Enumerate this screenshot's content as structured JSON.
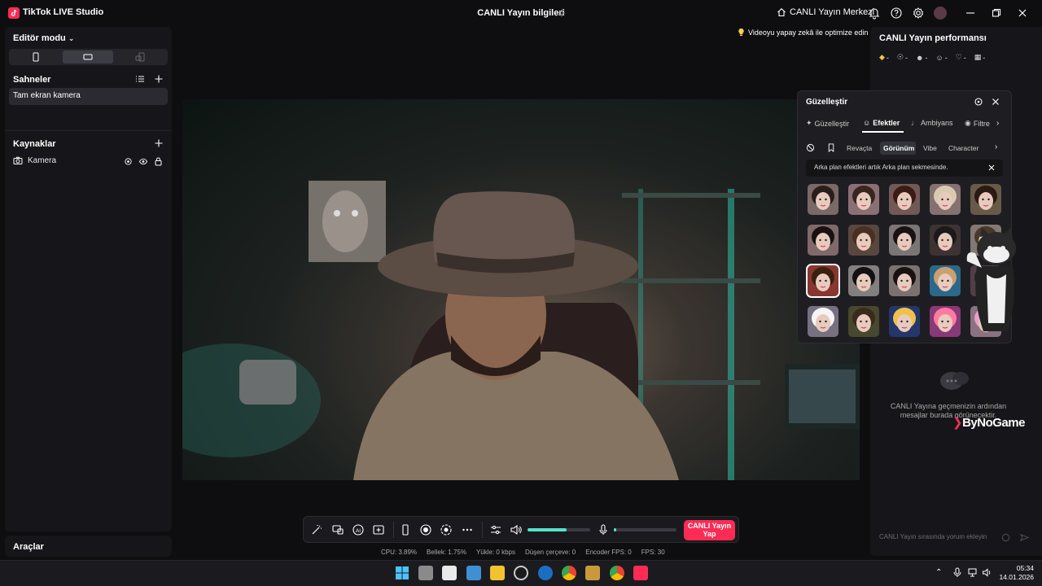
{
  "app": {
    "title": "TikTok LIVE Studio",
    "center_title": "CANLI Yayın bilgileri",
    "live_center": "CANLI Yayın Merkezi"
  },
  "left": {
    "editor_mode": "Editör modu",
    "scenes_label": "Sahneler",
    "scene_items": [
      "Tam ekran kamera"
    ],
    "sources_label": "Kaynaklar",
    "source_items": [
      "Kamera"
    ],
    "tools_label": "Araçlar"
  },
  "preview": {
    "ai_optimize": "Videoyu yapay zekâ ile optimize edin"
  },
  "right": {
    "perf_title": "CANLI Yayın performansı",
    "metrics": [
      "-",
      "-",
      "-",
      "-",
      "-",
      "-"
    ],
    "chat_empty": "CANLI Yayına geçmenizin ardından mesajlar burada görünecektir.",
    "chat_placeholder": "CANLI Yayın sırasında yorum ekleyin",
    "watermark": "ByNoGame"
  },
  "beauty": {
    "title": "Güzelleştir",
    "tabs": [
      "Güzelleştir",
      "Efektler",
      "Ambiyans",
      "Filtre"
    ],
    "sub_tabs": [
      "Revaçta",
      "Görünüm",
      "Vibe",
      "Character"
    ],
    "notice": "Arka plan efektleri artık Arka plan sekmesinde."
  },
  "controls": {
    "go_live": "CANLI Yayın Yap",
    "volume_level": 0.62,
    "mic_level": 0.04,
    "stats": [
      "CPU: 3.89%",
      "Bellek: 1.75%",
      "Yükle: 0 kbps",
      "Düşen çerçeve: 0",
      "Encoder FPS: 0",
      "FPS: 30"
    ]
  },
  "taskbar": {
    "time": "05:34",
    "date": "14.01.2026"
  },
  "colors": {
    "accent": "#fe2c55",
    "teal": "#52e5c8"
  }
}
